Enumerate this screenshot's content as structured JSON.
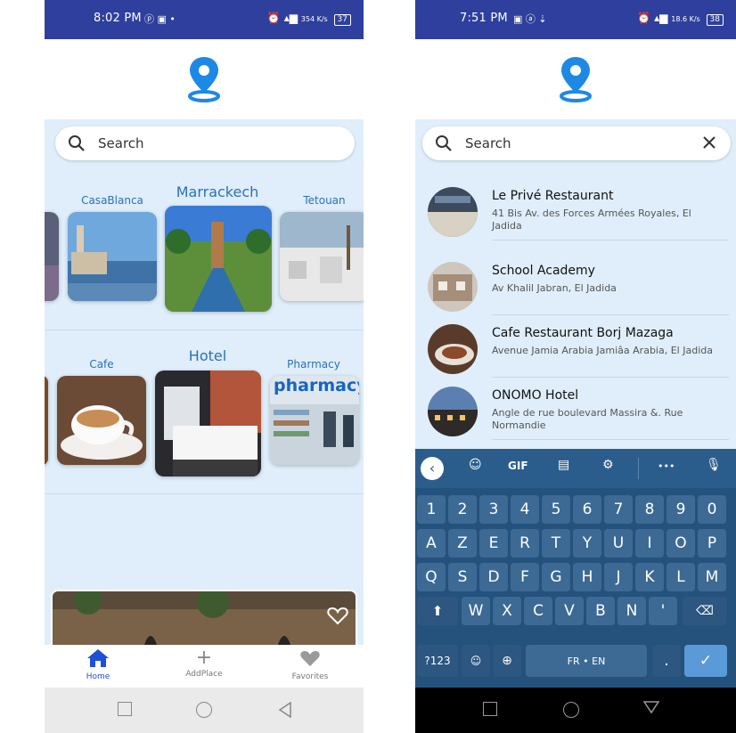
{
  "screen1": {
    "status": {
      "time": "8:02 PM",
      "notif_icons": "ⓟ ▣ •",
      "alarm_icon": "alarm-icon",
      "net_speed": "354 K/s",
      "battery": "37"
    },
    "search": {
      "placeholder": "Search"
    },
    "row1": [
      {
        "label": "CasaBlanca"
      },
      {
        "label": "Marrackech"
      },
      {
        "label": "Tetouan"
      }
    ],
    "row2": [
      {
        "label": "Cafe"
      },
      {
        "label": "Hotel"
      },
      {
        "label": "Pharmacy"
      }
    ],
    "pharmacy_sign": "pharmacy",
    "nav": [
      {
        "label": "Home",
        "icon": "home-icon",
        "active": true
      },
      {
        "label": "AddPlace",
        "icon": "plus-icon",
        "active": false
      },
      {
        "label": "Favorites",
        "icon": "heart-icon",
        "active": false
      }
    ],
    "colors": {
      "status_bar": "#2f3f9d",
      "accent": "#1e88e5",
      "background": "#dfeefa",
      "nav_active": "#1e4fd8"
    }
  },
  "screen2": {
    "status": {
      "time": "7:51 PM",
      "notif_icons": "▣ ⓐ ⇣",
      "alarm_icon": "alarm-icon",
      "net_speed": "18.6 K/s",
      "battery": "38"
    },
    "search": {
      "value": "Search"
    },
    "results": [
      {
        "name": "Le Privé Restaurant",
        "address": "41 Bis Av. des Forces Armées Royales, El Jadida"
      },
      {
        "name": "School Academy",
        "address": "Av Khalil Jabran, El Jadida"
      },
      {
        "name": "Cafe Restaurant Borj Mazaga",
        "address": "Avenue Jamia Arabia Jamiâa Arabia, El Jadida"
      },
      {
        "name": "ONOMO Hotel",
        "address": "Angle de rue boulevard Massira &. Rue Normandie"
      }
    ],
    "keyboard": {
      "toolbar": {
        "gif": "GIF",
        "more": "•••"
      },
      "number_row": [
        "1",
        "2",
        "3",
        "4",
        "5",
        "6",
        "7",
        "8",
        "9",
        "0"
      ],
      "row_a": [
        "A",
        "Z",
        "E",
        "R",
        "T",
        "Y",
        "U",
        "I",
        "O",
        "P"
      ],
      "row_q": [
        "Q",
        "S",
        "D",
        "F",
        "G",
        "H",
        "J",
        "K",
        "L",
        "M"
      ],
      "row_w": [
        "W",
        "X",
        "C",
        "V",
        "B",
        "N",
        "'"
      ],
      "bottom": {
        "sym": "?123",
        "space": "FR • EN",
        "period": "."
      }
    }
  }
}
